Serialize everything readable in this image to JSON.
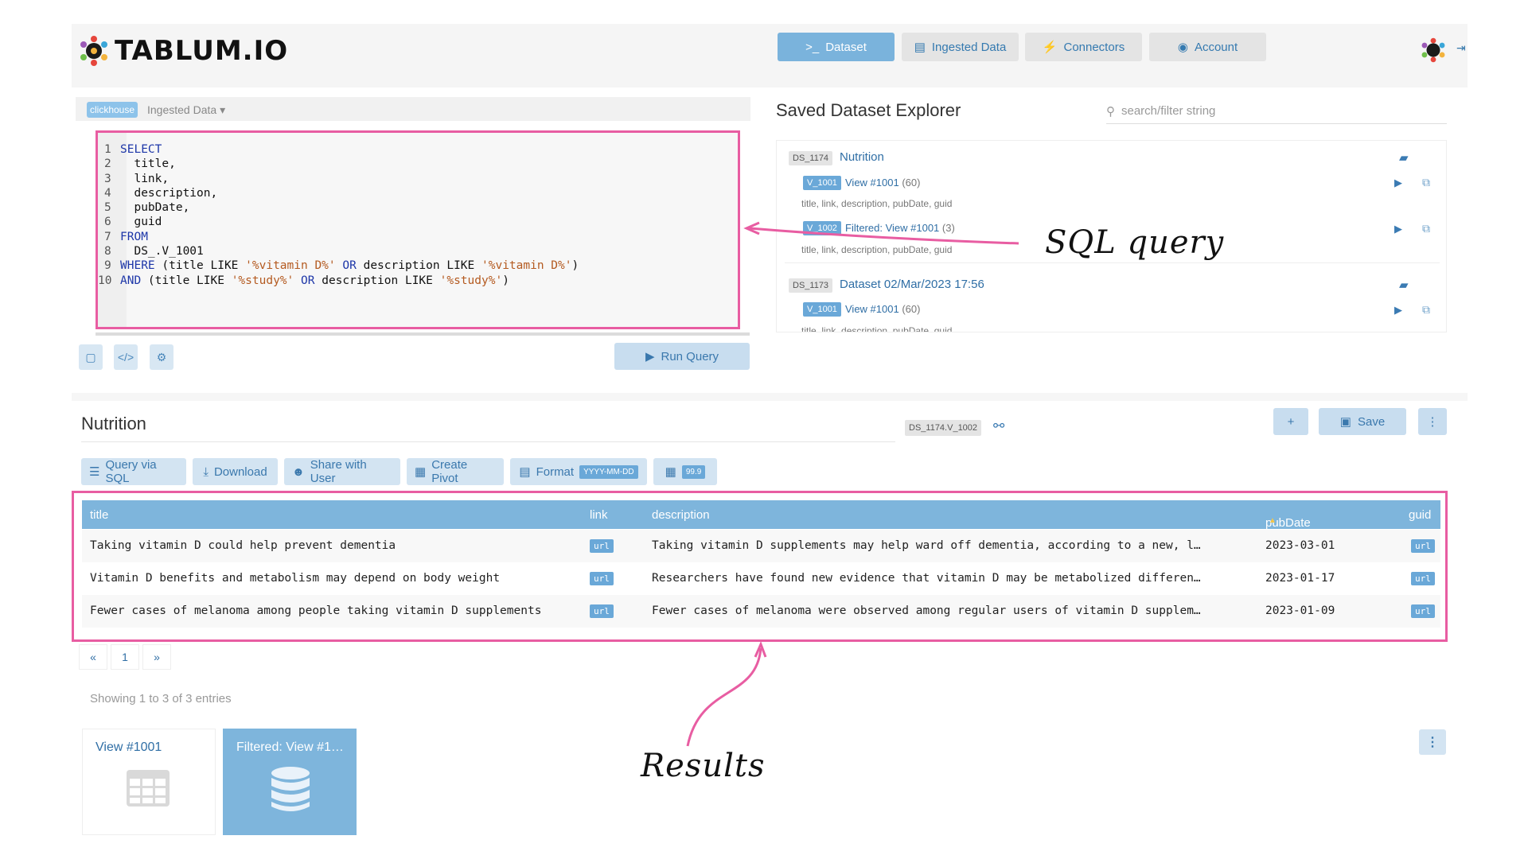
{
  "brand": {
    "name": "TABLUM.IO"
  },
  "nav": {
    "dataset": "Dataset",
    "ingested": "Ingested Data",
    "connectors": "Connectors",
    "account": "Account"
  },
  "query": {
    "engine_badge": "clickhouse",
    "source_dropdown": "Ingested Data",
    "line_numbers": [
      "1",
      "2",
      "3",
      "4",
      "5",
      "6",
      "7",
      "8",
      "9",
      "10"
    ],
    "run_label": "Run Query"
  },
  "explorer": {
    "title": "Saved Dataset Explorer",
    "search_placeholder": "search/filter string",
    "datasets": [
      {
        "tag": "DS_1174",
        "name": "Nutrition",
        "views": [
          {
            "tag": "V_1001",
            "name": "View #1001",
            "count": "(60)",
            "cols": "title, link, description, pubDate, guid"
          },
          {
            "tag": "V_1002",
            "name": "Filtered: View #1001",
            "count": "(3)",
            "cols": "title, link, description, pubDate, guid"
          }
        ]
      },
      {
        "tag": "DS_1173",
        "name": "Dataset 02/Mar/2023 17:56",
        "views": [
          {
            "tag": "V_1001",
            "name": "View #1001",
            "count": "(60)",
            "cols": "title, link, description, pubDate, guid"
          }
        ]
      }
    ]
  },
  "annotations": {
    "sql": "SQL query",
    "results": "Results"
  },
  "result": {
    "title": "Nutrition",
    "dataset_key": "DS_1174.V_1002",
    "save_label": "Save",
    "toolbar": {
      "query_sql": "Query via SQL",
      "download": "Download",
      "share": "Share with User",
      "pivot": "Create Pivot",
      "format": "Format",
      "format_value": "YYYY-MM-DD",
      "number_value": "99.9"
    },
    "columns": [
      "title",
      "link",
      "description",
      "pubDate",
      "guid"
    ],
    "rows": [
      {
        "title": "Taking vitamin D could help prevent dementia",
        "link": "url",
        "description": "Taking vitamin D supplements may help ward off dementia, according to a new, l…",
        "pubDate": "2023-03-01",
        "guid": "url"
      },
      {
        "title": "Vitamin D benefits and metabolism may depend on body weight",
        "link": "url",
        "description": "Researchers have found new evidence that vitamin D may be metabolized differen…",
        "pubDate": "2023-01-17",
        "guid": "url"
      },
      {
        "title": "Fewer cases of melanoma among people taking vitamin D supplements",
        "link": "url",
        "description": "Fewer cases of melanoma were observed among regular users of vitamin D supplem…",
        "pubDate": "2023-01-09",
        "guid": "url"
      }
    ],
    "pager": {
      "prev": "«",
      "page": "1",
      "next": "»"
    },
    "showing": "Showing 1 to 3 of 3 entries"
  },
  "view_cards": [
    {
      "title": "View #1001"
    },
    {
      "title": "Filtered: View #1…"
    }
  ],
  "colors": {
    "accent": "#7ab3dc",
    "highlight": "#e85da2"
  }
}
